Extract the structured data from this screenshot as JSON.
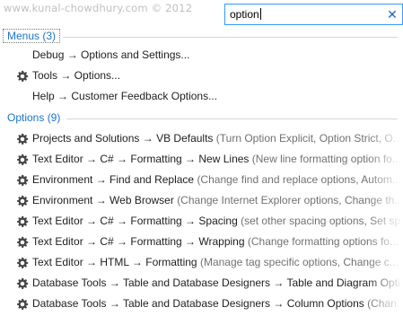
{
  "watermark": "www.kunal-chowdhury.com © 2012",
  "search": {
    "value": "option",
    "clear_icon": "close-icon"
  },
  "sections": {
    "menus": {
      "title": "Menus (3)",
      "items": [
        {
          "label": "Debug → Options and Settings...",
          "icon": null
        },
        {
          "label": "Tools → Options...",
          "icon": "gear-icon"
        },
        {
          "label": "Help → Customer Feedback Options...",
          "icon": null
        }
      ]
    },
    "options": {
      "title": "Options (9)",
      "items": [
        {
          "label": "Projects and Solutions → VB Defaults",
          "desc": "(Turn Option Explicit, Option Strict, O...",
          "icon": "gear-icon"
        },
        {
          "label": "Text Editor → C# → Formatting → New Lines",
          "desc": "(New line formatting option fo...",
          "icon": "gear-icon"
        },
        {
          "label": "Environment → Find and Replace",
          "desc": "(Change find and replace options, Autom...",
          "icon": "gear-icon"
        },
        {
          "label": "Environment → Web Browser",
          "desc": "(Change Internet Explorer options, Change th...",
          "icon": "gear-icon"
        },
        {
          "label": "Text Editor → C# → Formatting → Spacing",
          "desc": "(set other spacing options, Set sp...",
          "icon": "gear-icon"
        },
        {
          "label": "Text Editor → C# → Formatting → Wrapping",
          "desc": "(Change formatting options fo...",
          "icon": "gear-icon"
        },
        {
          "label": "Text Editor → HTML → Formatting",
          "desc": "(Manage tag specific options, Change c...",
          "icon": "gear-icon"
        },
        {
          "label": "Database Tools → Table and Database Designers → Table and Diagram Opti...",
          "desc": "",
          "icon": "gear-icon"
        },
        {
          "label": "Database Tools → Table and Database Designers → Column Options",
          "desc": "(Chan...",
          "icon": "gear-icon"
        }
      ]
    }
  },
  "colors": {
    "accent": "#1e74c9",
    "focus_border": "#3399ff",
    "desc_text": "#717171"
  }
}
